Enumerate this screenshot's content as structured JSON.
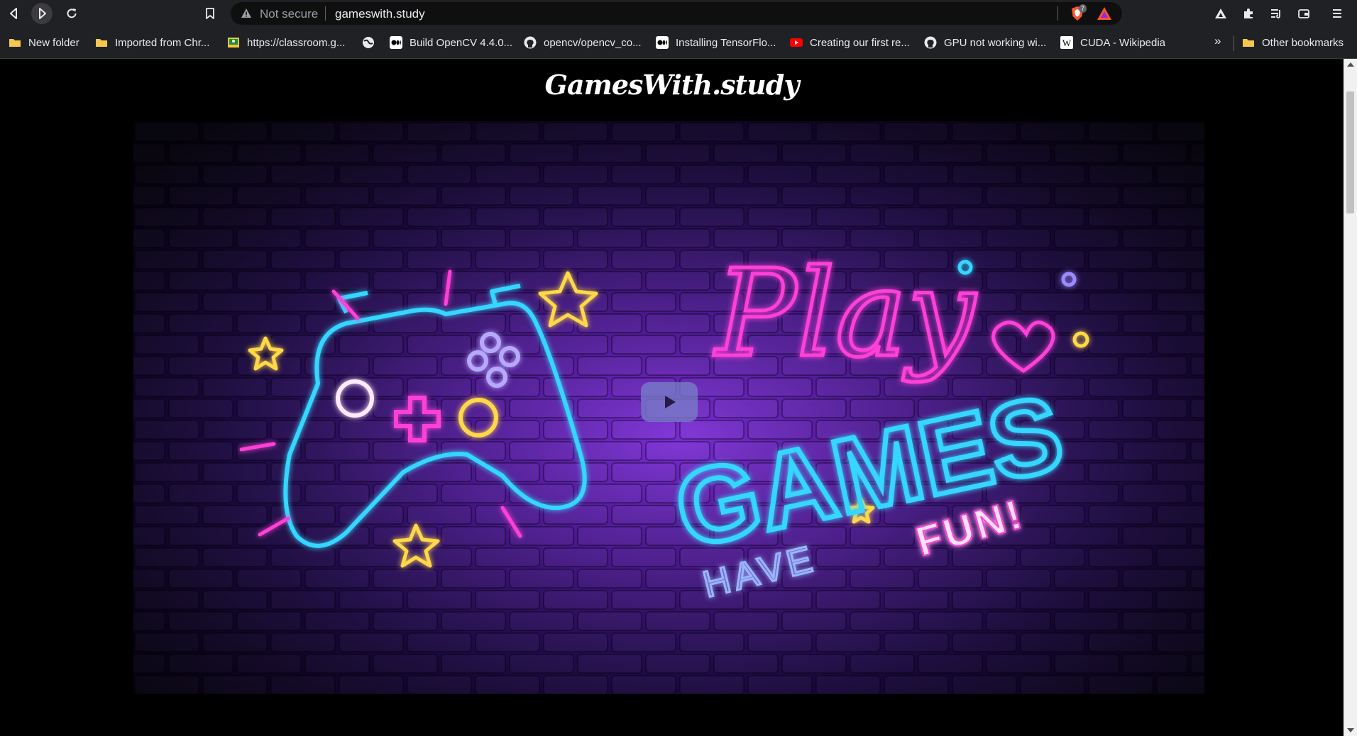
{
  "browser": {
    "security_label": "Not secure",
    "url": "gameswith.study",
    "shield_count": "7"
  },
  "bookmarks": [
    {
      "label": "New folder",
      "icon": "folder-icon"
    },
    {
      "label": "Imported from Chr...",
      "icon": "folder-icon"
    },
    {
      "label": "https://classroom.g...",
      "icon": "classroom-icon"
    },
    {
      "label": "",
      "icon": "globe-icon"
    },
    {
      "label": "Build OpenCV 4.4.0...",
      "icon": "medium-icon"
    },
    {
      "label": "opencv/opencv_co...",
      "icon": "github-icon"
    },
    {
      "label": "Installing TensorFlo...",
      "icon": "medium-icon"
    },
    {
      "label": "Creating our first re...",
      "icon": "youtube-icon"
    },
    {
      "label": "GPU not working wi...",
      "icon": "github-icon"
    },
    {
      "label": "CUDA - Wikipedia",
      "icon": "wikipedia-icon"
    }
  ],
  "bookmarks_more": "»",
  "other_bookmarks": "Other bookmarks",
  "page": {
    "logo": "GamesWith.study",
    "hero": {
      "script_word": "Play",
      "main_word": "GAMES",
      "sub_left": "HAVE",
      "sub_right": "FUN!",
      "play_button_icon": "play-icon"
    }
  },
  "colors": {
    "neon_blue": "#35d6ff",
    "neon_pink": "#ff3fd8",
    "neon_yellow": "#ffd84a",
    "brick_base": "#4a1fa0"
  }
}
